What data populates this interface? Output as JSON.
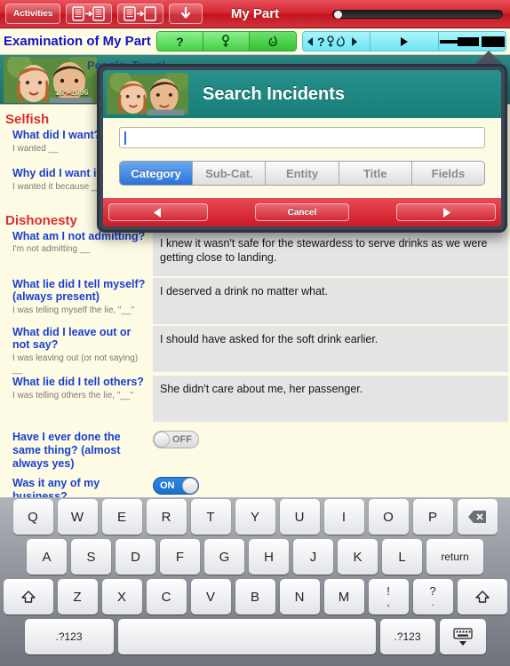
{
  "topbar": {
    "activities_label": "Activities",
    "title": "My Part",
    "icons": [
      "doc-to-doc-right-icon",
      "doc-to-doc-left-icon",
      "down-arrow-icon"
    ],
    "slider_value": "0"
  },
  "subbar": {
    "title": "Examination of My Part",
    "green_segments": [
      "?",
      "♀",
      "♂"
    ],
    "cyan_segments": [
      "◀ ? ♀♂ ▶",
      "▶",
      "bar"
    ]
  },
  "hero": {
    "counter": "16 / 1096",
    "label": "People: Travel"
  },
  "sections": [
    {
      "title": "Selfish",
      "items": [
        {
          "question": "What did I want?",
          "hint": "I wanted __",
          "answer": ""
        },
        {
          "question": "Why did I want it?",
          "hint": "I wanted it because __",
          "answer": ""
        }
      ]
    },
    {
      "title": "Dishonesty",
      "items": [
        {
          "question": "What am I not admitting?",
          "hint": "I'm not admitting __",
          "answer": "I knew it wasn't safe for the stewardess to serve drinks as we were getting close to landing."
        },
        {
          "question": "What lie did I tell myself? (always present)",
          "hint": "I was telling myself the lie, \"__\"",
          "answer": "I deserved a drink no matter what."
        },
        {
          "question": "What did I leave out or not say?",
          "hint": "I was leaving out (or not saying) __",
          "answer": "I should have asked for the soft drink earlier."
        },
        {
          "question": "What lie did I tell others?",
          "hint": "I was telling others the lie, \"__\"",
          "answer": "She didn't care about me, her passenger."
        }
      ],
      "toggles": [
        {
          "question": "Have I ever done the same thing? (almost always yes)",
          "state": "OFF",
          "on": false
        },
        {
          "question": "Was it any of my business?",
          "state": "ON",
          "on": true
        }
      ]
    }
  ],
  "modal": {
    "title": "Search Incidents",
    "search_value": "",
    "search_placeholder": "",
    "tabs": [
      {
        "label": "Category",
        "selected": true
      },
      {
        "label": "Sub-Cat.",
        "selected": false
      },
      {
        "label": "Entity",
        "selected": false
      },
      {
        "label": "Title",
        "selected": false
      },
      {
        "label": "Fields",
        "selected": false
      }
    ],
    "footer": {
      "prev_label": "◀",
      "cancel_label": "Cancel",
      "next_label": "▶"
    }
  },
  "keyboard": {
    "row1": [
      "Q",
      "W",
      "E",
      "R",
      "T",
      "Y",
      "U",
      "I",
      "O",
      "P"
    ],
    "backspace_label": "⌫",
    "row2": [
      "A",
      "S",
      "D",
      "F",
      "G",
      "H",
      "J",
      "K",
      "L"
    ],
    "return_label": "return",
    "shift_label": "⇧",
    "row3": [
      "Z",
      "X",
      "C",
      "V",
      "B",
      "N",
      "M"
    ],
    "punct1_top": "!",
    "punct1_bottom": ",",
    "punct2_top": "?",
    "punct2_bottom": ".",
    "num_label": ".?123",
    "num_label2": ".?123",
    "space_label": "",
    "hide_label": "⌨"
  },
  "colors": {
    "toolbar_red": "#d4252f",
    "teal": "#1c8a85",
    "question_blue": "#1a3fd0",
    "section_red": "#d83030",
    "accent_blue": "#2a72d8",
    "page_cream": "#fdfbe4"
  }
}
